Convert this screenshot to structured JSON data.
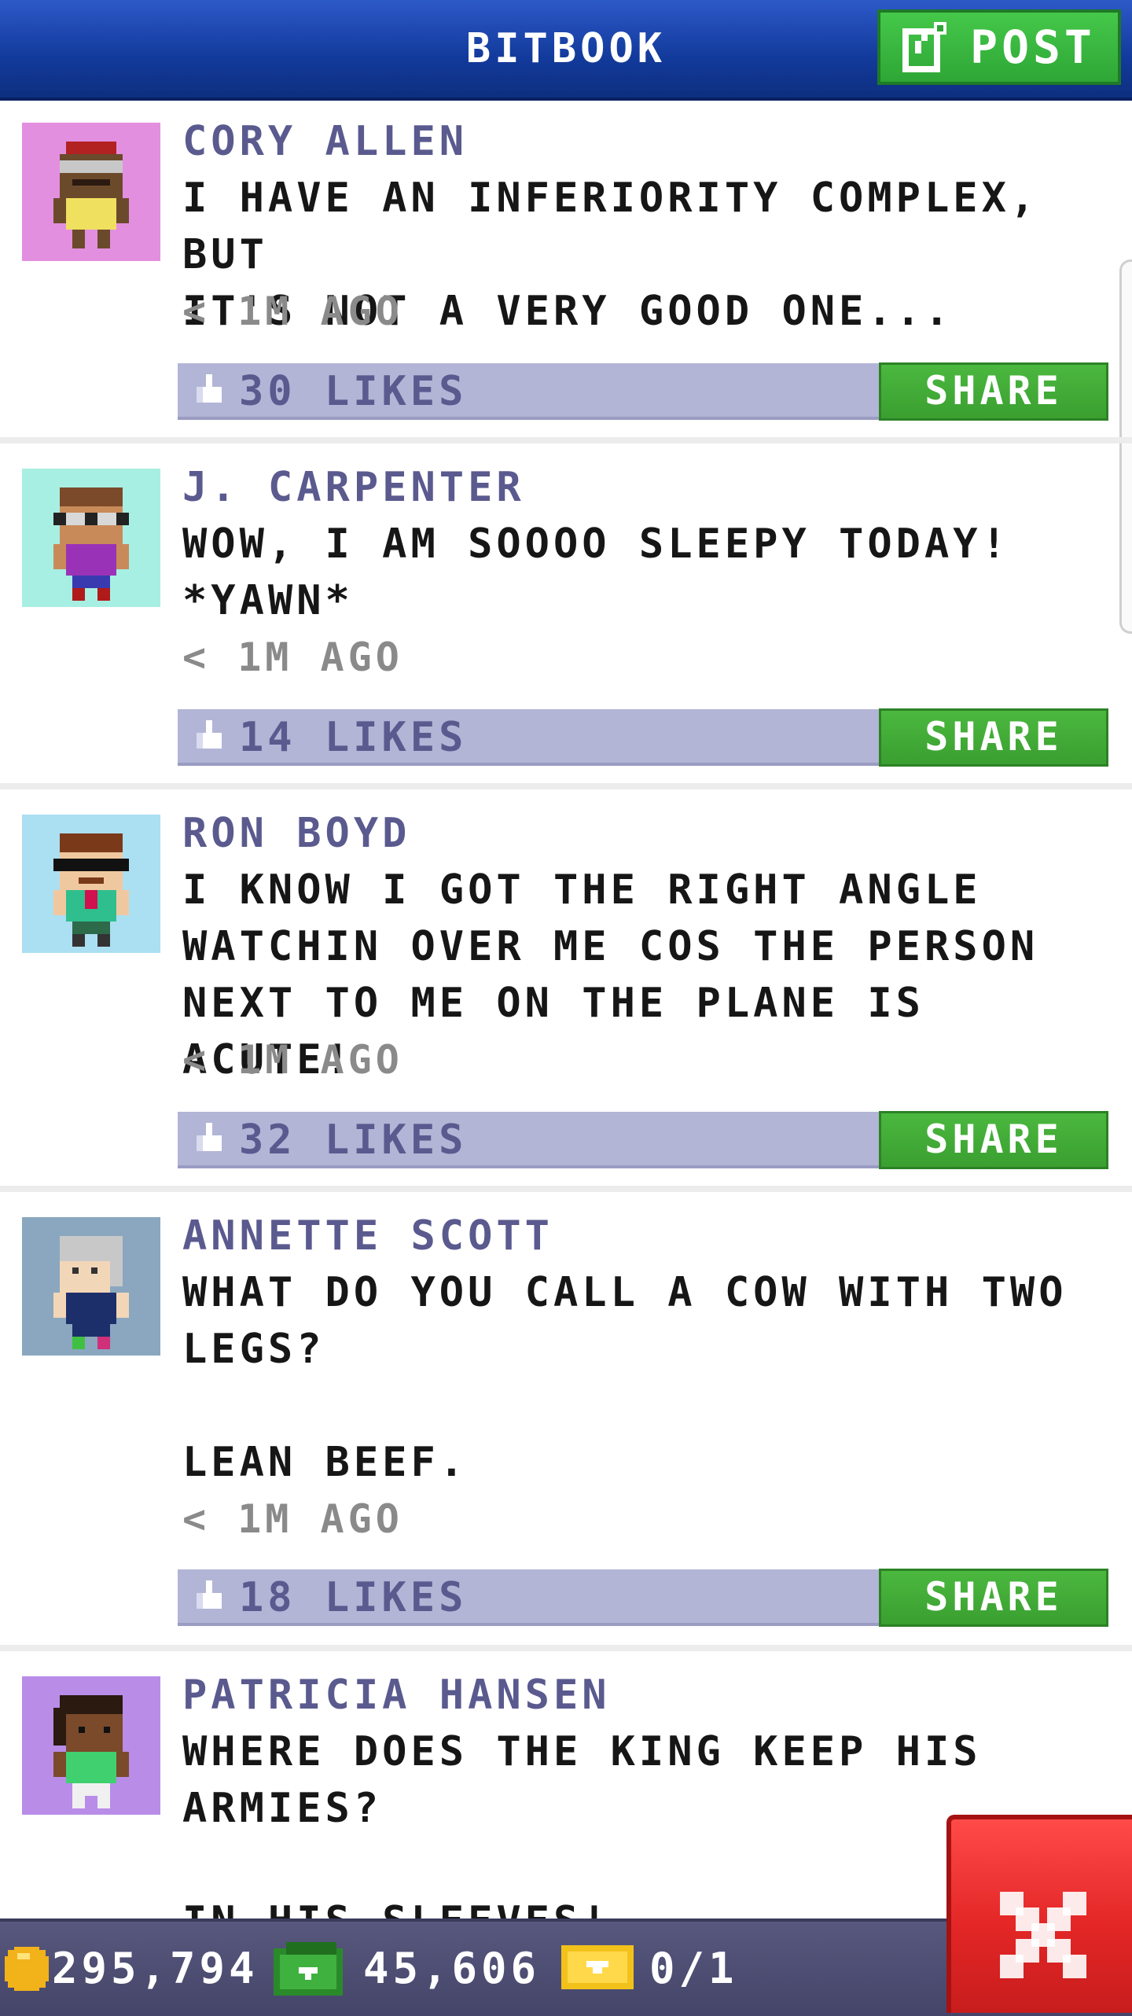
{
  "header": {
    "title": "BITBOOK",
    "post_label": "POST"
  },
  "posts": [
    {
      "name": "CORY ALLEN",
      "text": "I HAVE AN INFERIORITY COMPLEX, BUT\nIT'S NOT A VERY GOOD ONE...",
      "time": "< 1M AGO",
      "likes": "30 LIKES",
      "share": "SHARE",
      "avatar_bg": "#e38fe0"
    },
    {
      "name": "J. CARPENTER",
      "text": "WOW, I AM SOOOO SLEEPY TODAY!\n*YAWN*",
      "time": "< 1M AGO",
      "likes": "14 LIKES",
      "share": "SHARE",
      "avatar_bg": "#a8efe3"
    },
    {
      "name": "RON BOYD",
      "text": "I KNOW I GOT THE RIGHT ANGLE\nWATCHIN OVER ME COS THE PERSON\nNEXT TO ME ON THE PLANE IS ACUTE!",
      "time": "< 1M AGO",
      "likes": "32 LIKES",
      "share": "SHARE",
      "avatar_bg": "#abdff2"
    },
    {
      "name": "ANNETTE SCOTT",
      "text": "WHAT DO YOU CALL A COW WITH TWO\nLEGS?\n\nLEAN BEEF.",
      "time": "< 1M AGO",
      "likes": "18 LIKES",
      "share": "SHARE",
      "avatar_bg": "#8aa7bf"
    },
    {
      "name": "PATRICIA HANSEN",
      "text": "WHERE DOES THE KING KEEP HIS\nARMIES?\n\nIN HIS SLEEVES!",
      "avatar_bg": "#b98ce8"
    }
  ],
  "resources": {
    "coins": "295,794",
    "bux": "45,606",
    "tickets": "0/1"
  },
  "colors": {
    "header_blue": "#1a43ad",
    "share_green": "#3fa834",
    "likes_bar": "#b3b5d6",
    "name_purple": "#5a5a8f",
    "close_red": "#e32626"
  },
  "icons": [
    "edit-icon",
    "thumbs-up-icon",
    "coin-icon",
    "bux-icon",
    "ticket-icon",
    "close-icon"
  ]
}
